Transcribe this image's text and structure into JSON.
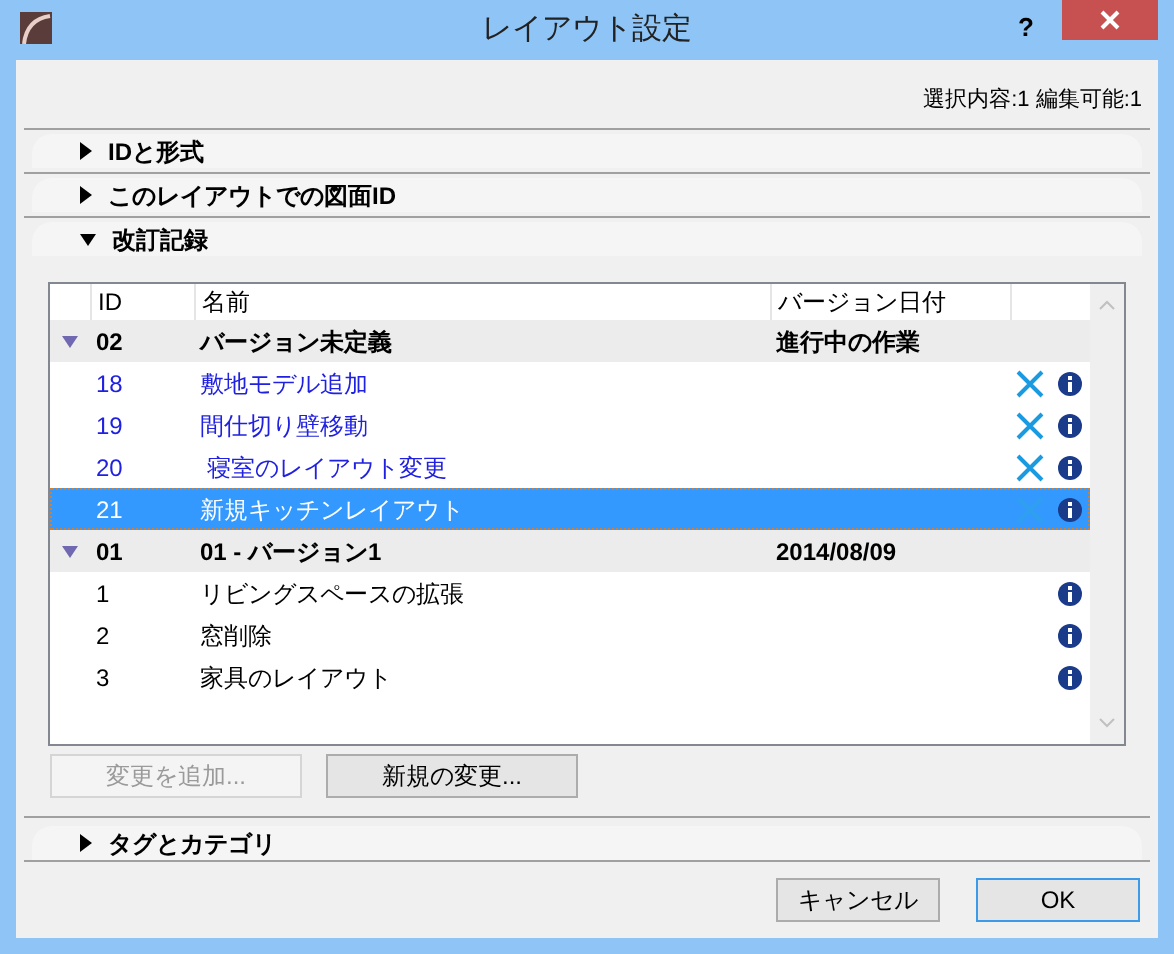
{
  "window": {
    "title": "レイアウト設定",
    "help": "?"
  },
  "selection_info": "選択内容:1 編集可能:1",
  "sections": [
    {
      "label": "IDと形式",
      "expanded": false
    },
    {
      "label": "このレイアウトでの図面ID",
      "expanded": false
    },
    {
      "label": "改訂記録",
      "expanded": true
    }
  ],
  "revisions": {
    "columns": [
      "ID",
      "名前",
      "バージョン日付"
    ],
    "groups": [
      {
        "id": "02",
        "name": "バージョン未定義",
        "date": "進行中の作業",
        "expanded": true,
        "children": [
          {
            "id": "18",
            "name": "敷地モデル追加",
            "editable": true,
            "selected": false
          },
          {
            "id": "19",
            "name": "間仕切り壁移動",
            "editable": true,
            "selected": false
          },
          {
            "id": "20",
            "name": " 寝室のレイアウト変更",
            "editable": true,
            "selected": false
          },
          {
            "id": "21",
            "name": "新規キッチンレイアウト",
            "editable": true,
            "selected": true
          }
        ]
      },
      {
        "id": "01",
        "name": "01 - バージョン1",
        "date": "2014/08/09",
        "expanded": true,
        "children": [
          {
            "id": "1",
            "name": "リビングスペースの拡張",
            "editable": false,
            "selected": false
          },
          {
            "id": "2",
            "name": "窓削除",
            "editable": false,
            "selected": false
          },
          {
            "id": "3",
            "name": "家具のレイアウト",
            "editable": false,
            "selected": false
          }
        ]
      }
    ]
  },
  "list_buttons": [
    {
      "label": "変更を追加...",
      "disabled": true
    },
    {
      "label": "新規の変更...",
      "disabled": false
    }
  ],
  "bottom_section": {
    "label": "タグとカテゴリ",
    "expanded": false
  },
  "buttons": [
    {
      "label": "キャンセル",
      "default": false
    },
    {
      "label": "OK",
      "default": true
    }
  ]
}
